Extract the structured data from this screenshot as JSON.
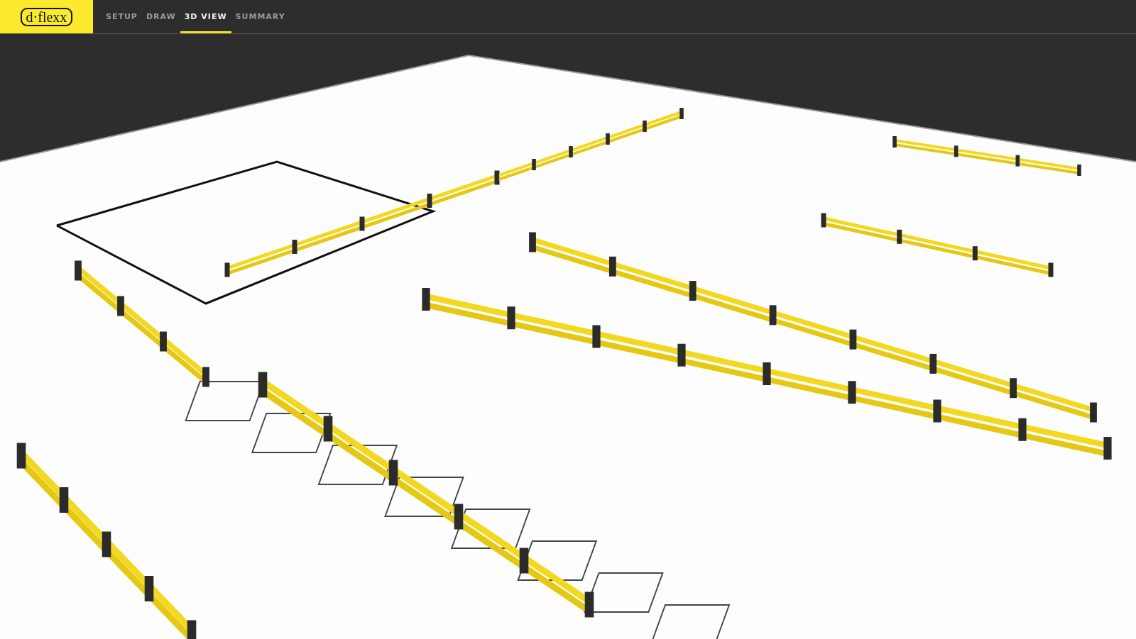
{
  "logo": "d·flexx",
  "tabs": [
    {
      "label": "SETUP",
      "selected": false
    },
    {
      "label": "DRAW",
      "selected": false
    },
    {
      "label": "3D VIEW",
      "selected": true
    },
    {
      "label": "SUMMARY",
      "selected": false
    }
  ]
}
